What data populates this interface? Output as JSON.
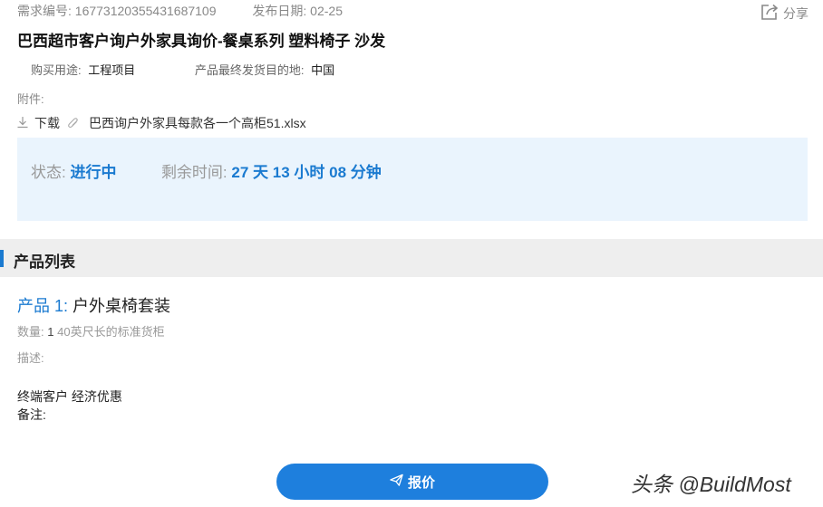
{
  "header": {
    "request_no": "需求编号: 16773120355431687109",
    "publish_date": "发布日期: 02-25",
    "share_label": "分享"
  },
  "title": "巴西超市客户询户外家具询价-餐桌系列 塑料椅子 沙发",
  "info": {
    "purpose_label": "购买用途:",
    "purpose_value": "工程项目",
    "destination_label": "产品最终发货目的地:",
    "destination_value": "中国"
  },
  "attachment": {
    "label": "附件:",
    "download_label": "下载",
    "file_name": "巴西询户外家具每款各一个高柜51.xlsx"
  },
  "status": {
    "status_label": "状态:",
    "status_value": "进行中",
    "remaining_label": "剩余时间:",
    "remaining_value": "27 天 13 小时 08 分钟"
  },
  "section": {
    "title": "产品列表"
  },
  "product": {
    "index_label": "产品 1:",
    "name": "户外桌椅套装",
    "qty_label": "数量:",
    "qty_value": "1",
    "qty_unit": "40英尺长的标准货柜",
    "desc_label": "描述:",
    "desc_text": "终端客户 经济优惠",
    "remark_label": "备注:"
  },
  "actions": {
    "quote_label": "报价"
  },
  "watermark": "头条 @BuildMost",
  "colors": {
    "accent": "#1a7ad0",
    "status_bg": "#eaf4fd",
    "section_bg": "#eeeeee",
    "button": "#1e7fdd"
  }
}
